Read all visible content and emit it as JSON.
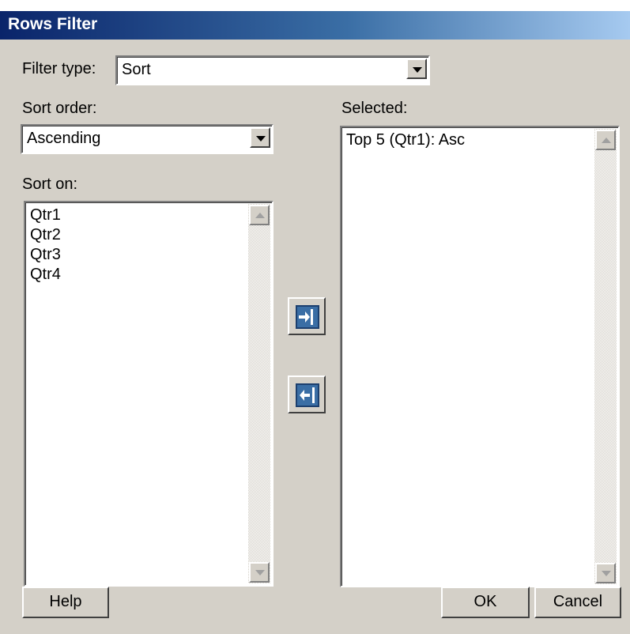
{
  "window": {
    "title": "Rows Filter"
  },
  "filter_type": {
    "label": "Filter type:",
    "value": "Sort"
  },
  "sort_order": {
    "label": "Sort order:",
    "value": "Ascending"
  },
  "sort_on": {
    "label": "Sort on:",
    "items": [
      "Qtr1",
      "Qtr2",
      "Qtr3",
      "Qtr4"
    ]
  },
  "selected": {
    "label": "Selected:",
    "items": [
      "Top 5 (Qtr1): Asc"
    ]
  },
  "buttons": {
    "help": "Help",
    "ok": "OK",
    "cancel": "Cancel"
  },
  "icons": {
    "add": "arrow-right-into-box-icon",
    "remove": "arrow-left-out-of-box-icon"
  },
  "colors": {
    "title_start": "#0a246a",
    "title_end": "#a6caf0",
    "face": "#d4d0c8",
    "icon_blue": "#3a6ea5"
  }
}
